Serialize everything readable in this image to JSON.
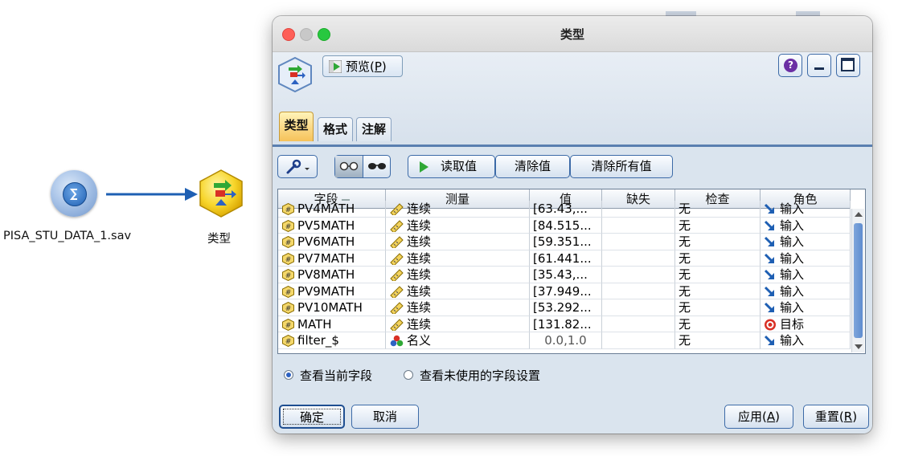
{
  "canvas": {
    "source_node_label": "PISA_STU_DATA_1.sav",
    "type_node_label": "类型"
  },
  "dialog": {
    "title": "类型",
    "preview_label": "预览(",
    "preview_key": "P",
    "preview_close": ")",
    "tabs": [
      {
        "label": "类型",
        "active": true
      },
      {
        "label": "格式",
        "active": false
      },
      {
        "label": "注解",
        "active": false
      }
    ],
    "toolbar": {
      "read_values": "读取值",
      "clear_values": "清除值",
      "clear_all_values": "清除所有值"
    },
    "table": {
      "columns": [
        "字段",
        "测量",
        "值",
        "缺失",
        "检查",
        "角色"
      ],
      "rows": [
        {
          "field": "PV4MATH",
          "measure": "连续",
          "value": "[63.43,...",
          "missing": "",
          "check": "无",
          "role": "输入"
        },
        {
          "field": "PV5MATH",
          "measure": "连续",
          "value": "[84.515...",
          "missing": "",
          "check": "无",
          "role": "输入"
        },
        {
          "field": "PV6MATH",
          "measure": "连续",
          "value": "[59.351...",
          "missing": "",
          "check": "无",
          "role": "输入"
        },
        {
          "field": "PV7MATH",
          "measure": "连续",
          "value": "[61.441...",
          "missing": "",
          "check": "无",
          "role": "输入"
        },
        {
          "field": "PV8MATH",
          "measure": "连续",
          "value": "[35.43,...",
          "missing": "",
          "check": "无",
          "role": "输入"
        },
        {
          "field": "PV9MATH",
          "measure": "连续",
          "value": "[37.949...",
          "missing": "",
          "check": "无",
          "role": "输入"
        },
        {
          "field": "PV10MATH",
          "measure": "连续",
          "value": "[53.292...",
          "missing": "",
          "check": "无",
          "role": "输入"
        },
        {
          "field": "MATH",
          "measure": "连续",
          "value": "[131.82...",
          "missing": "",
          "check": "无",
          "role": "目标"
        },
        {
          "field": "filter_$",
          "measure": "名义",
          "value": "0.0,1.0",
          "missing": "",
          "check": "无",
          "role": "输入"
        }
      ]
    },
    "view_options": {
      "current_fields": "查看当前字段",
      "unused_field_settings": "查看未使用的字段设置",
      "selected": "current_fields"
    },
    "buttons": {
      "ok": "确定",
      "cancel": "取消",
      "apply_label": "应用(",
      "apply_key": "A",
      "apply_close": ")",
      "reset_label": "重置(",
      "reset_key": "R",
      "reset_close": ")"
    }
  },
  "icons": {
    "source_node": "database-icon",
    "type_node": "type-node-icon",
    "field": "numeric-field-icon",
    "continuous": "ruler-icon",
    "nominal": "nominal-set-icon",
    "input_role": "input-arrow-icon",
    "target_role": "target-icon",
    "help": "help-icon",
    "wrench": "wrench-icon"
  },
  "colors": {
    "active_tab": "#f6c25a",
    "dialog_bg": "#dce6f0",
    "accent_blue": "#3c6aa7",
    "connector": "#1e5fb3",
    "play_green": "#2fa836",
    "target_red": "#d93025"
  }
}
